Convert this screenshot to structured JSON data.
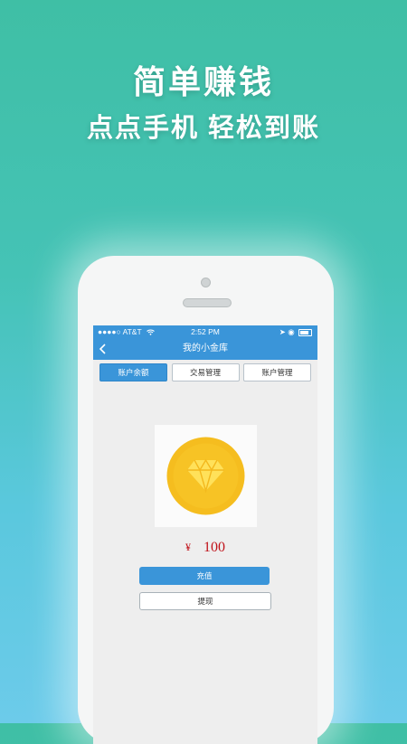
{
  "promo": {
    "title": "简单赚钱",
    "subtitle": "点点手机 轻松到账"
  },
  "statusbar": {
    "carrier": "●●●●○ AT&T",
    "time": "2:52 PM",
    "wifi_icon": "wifi-icon",
    "location_icon": "location-arrow-icon"
  },
  "navbar": {
    "title": "我的小金库",
    "back_icon": "chevron-left-icon"
  },
  "tabs": [
    {
      "label": "账户余额",
      "active": true
    },
    {
      "label": "交易管理",
      "active": false
    },
    {
      "label": "账户管理",
      "active": false
    }
  ],
  "balance": {
    "icon": "diamond-coin-icon",
    "currency": "¥",
    "amount": "100"
  },
  "actions": {
    "recharge": "充值",
    "withdraw": "提现"
  },
  "colors": {
    "accent": "#3a95d9",
    "amount": "#c0121a",
    "coin": "#f7c325",
    "diamond": "#ffe15a"
  }
}
